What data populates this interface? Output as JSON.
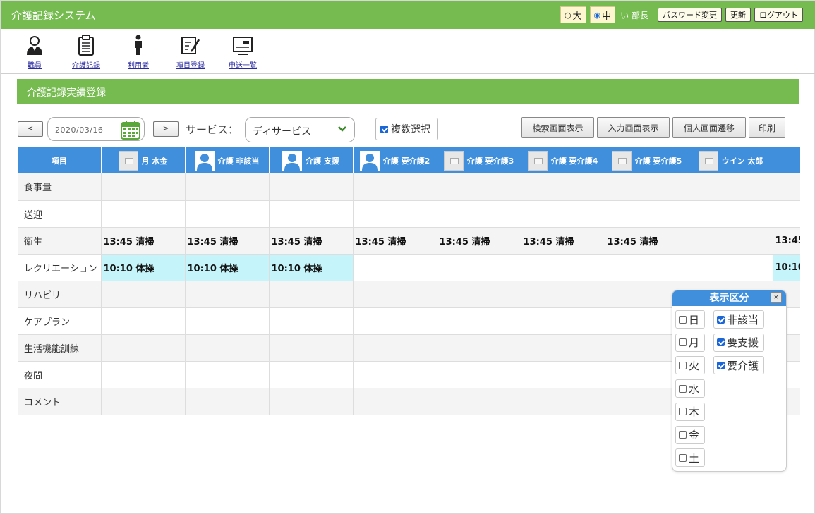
{
  "app": {
    "title": "介護記録システム"
  },
  "header": {
    "size_large": "大",
    "size_medium": "中",
    "user": "い 部長",
    "password_button": "パスワード変更",
    "refresh_button": "更新",
    "logout_button": "ログアウト"
  },
  "nav": {
    "items": [
      {
        "label": "職員",
        "icon": "staff-icon"
      },
      {
        "label": "介護記録",
        "icon": "clipboard-icon"
      },
      {
        "label": "利用者",
        "icon": "person-icon"
      },
      {
        "label": "項目登録",
        "icon": "edit-document-icon"
      },
      {
        "label": "申送一覧",
        "icon": "display-icon"
      }
    ]
  },
  "section": {
    "title": "介護記録実績登録"
  },
  "toolbar": {
    "prev_label": "<",
    "next_label": ">",
    "date": "2020/03/16",
    "service_label": "サービス：",
    "service_value": "ディサービス",
    "multi_select_label": "複数選択",
    "multi_select_checked": true,
    "search_view_button": "検索画面表示",
    "input_view_button": "入力画面表示",
    "personal_view_button": "個人画面遷移",
    "print_button": "印刷"
  },
  "grid": {
    "item_header": "項目",
    "columns": [
      {
        "name": "月 水金",
        "photo": "no-image"
      },
      {
        "name": "介護 非該当",
        "photo": "avatar"
      },
      {
        "name": "介護 支援",
        "photo": "avatar"
      },
      {
        "name": "介護 要介護2",
        "photo": "avatar"
      },
      {
        "name": "介護 要介護3",
        "photo": "no-image"
      },
      {
        "name": "介護 要介護4",
        "photo": "no-image"
      },
      {
        "name": "介護 要介護5",
        "photo": "no-image"
      },
      {
        "name": "ウイン 太郎",
        "photo": "no-image"
      },
      {
        "name": "",
        "photo": "avatar"
      }
    ],
    "rows": [
      {
        "label": "食事量",
        "cells": [
          "",
          "",
          "",
          "",
          "",
          "",
          "",
          "",
          ""
        ]
      },
      {
        "label": "送迎",
        "cells": [
          "",
          "",
          "",
          "",
          "",
          "",
          "",
          "",
          ""
        ]
      },
      {
        "label": "衛生",
        "cells": [
          "13:45 清掃",
          "13:45 清掃",
          "13:45 清掃",
          "13:45 清掃",
          "13:45 清掃",
          "13:45 清掃",
          "13:45 清掃",
          "",
          "13:45"
        ]
      },
      {
        "label": "レクリエーション",
        "cells": [
          "10:10 体操",
          "10:10 体操",
          "10:10 体操",
          "",
          "",
          "",
          "",
          "",
          "10:10"
        ]
      },
      {
        "label": "リハビリ",
        "cells": [
          "",
          "",
          "",
          "",
          "",
          "",
          "",
          "",
          ""
        ]
      },
      {
        "label": "ケアプラン",
        "cells": [
          "",
          "",
          "",
          "",
          "",
          "",
          "",
          "",
          ""
        ]
      },
      {
        "label": "生活機能訓練",
        "cells": [
          "",
          "",
          "",
          "",
          "",
          "",
          "",
          "",
          ""
        ]
      },
      {
        "label": "夜間",
        "cells": [
          "",
          "",
          "",
          "",
          "",
          "",
          "",
          "",
          ""
        ]
      },
      {
        "label": "コメント",
        "cells": [
          "",
          "",
          "",
          "",
          "",
          "",
          "",
          "",
          ""
        ]
      }
    ]
  },
  "display_filter": {
    "title": "表示区分",
    "close": "×",
    "days": [
      {
        "label": "日",
        "checked": false
      },
      {
        "label": "月",
        "checked": false
      },
      {
        "label": "火",
        "checked": false
      },
      {
        "label": "水",
        "checked": false
      },
      {
        "label": "木",
        "checked": false
      },
      {
        "label": "金",
        "checked": false
      },
      {
        "label": "土",
        "checked": false
      }
    ],
    "care_levels": [
      {
        "label": "非該当",
        "checked": true
      },
      {
        "label": "要支援",
        "checked": true
      },
      {
        "label": "要介護",
        "checked": true
      }
    ]
  },
  "colors": {
    "header_green": "#76bb50",
    "grid_blue": "#3f8fdc",
    "highlight_cyan": "#c5f5fa"
  }
}
